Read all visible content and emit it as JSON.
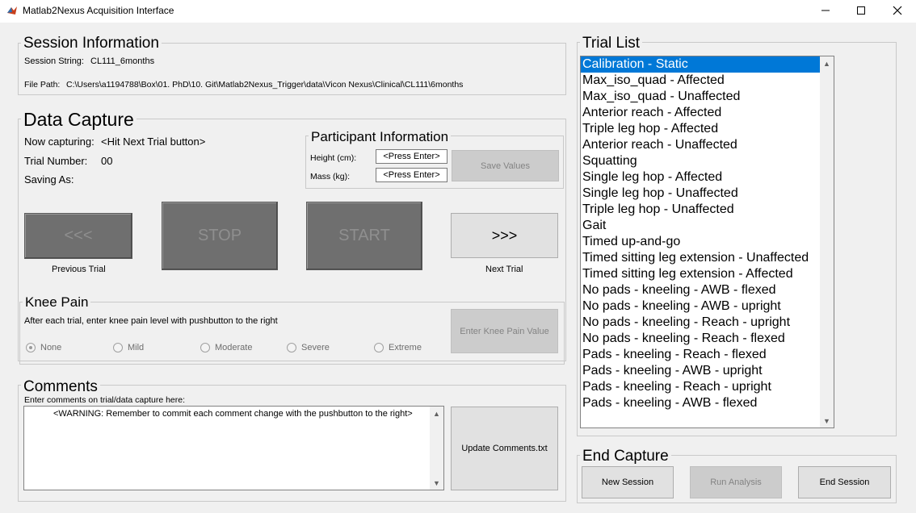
{
  "window": {
    "title": "Matlab2Nexus Acquisition Interface",
    "minimize_glyph": "—",
    "maximize_glyph": "☐",
    "close_glyph": "✕"
  },
  "session": {
    "title": "Session Information",
    "session_string_label": "Session String:",
    "session_string_value": "CL111_6months",
    "file_path_label": "File Path:",
    "file_path_value": "C:\\Users\\a1194788\\Box\\01. PhD\\10. Git\\Matlab2Nexus_Trigger\\data\\Vicon Nexus\\Clinical\\CL111\\6months"
  },
  "data_capture": {
    "title": "Data Capture",
    "now_capturing_label": "Now capturing:",
    "now_capturing_value": "<Hit Next Trial button>",
    "trial_number_label": "Trial Number:",
    "trial_number_value": "00",
    "saving_as_label": "Saving As:",
    "prev_button": "<<<",
    "prev_caption": "Previous Trial",
    "stop_button": "STOP",
    "start_button": "START",
    "next_button": ">>>",
    "next_caption": "Next Trial"
  },
  "participant": {
    "title": "Participant Information",
    "height_label": "Height (cm):",
    "height_value": "<Press Enter>",
    "mass_label": "Mass (kg):",
    "mass_value": "<Press Enter>",
    "save_button": "Save Values"
  },
  "knee_pain": {
    "title": "Knee Pain",
    "instruction": "After each trial, enter knee pain level with pushbutton to the right",
    "options": [
      "None",
      "Mild",
      "Moderate",
      "Severe",
      "Extreme"
    ],
    "selected": "None",
    "enter_button": "Enter Knee Pain Value"
  },
  "comments": {
    "title": "Comments",
    "instruction": "Enter comments on trial/data capture here:",
    "text": "<WARNING: Remember to commit each comment change with the pushbutton to the right>",
    "update_button": "Update Comments.txt"
  },
  "trial_list": {
    "title": "Trial List",
    "selected_index": 0,
    "items": [
      "Calibration - Static",
      "Max_iso_quad - Affected",
      "Max_iso_quad - Unaffected",
      "Anterior reach - Affected",
      "Triple leg hop - Affected",
      "Anterior reach - Unaffected",
      "Squatting",
      "Single leg hop - Affected",
      "Single leg hop - Unaffected",
      "Triple leg hop - Unaffected",
      "Gait",
      "Timed up-and-go",
      "Timed sitting leg extension - Unaffected",
      "Timed sitting leg extension - Affected",
      "No pads - kneeling - AWB - flexed",
      "No pads - kneeling - AWB - upright",
      "No pads - kneeling - Reach - upright",
      "No pads - kneeling - Reach - flexed",
      "Pads - kneeling - Reach - flexed",
      "Pads - kneeling - AWB - upright",
      "Pads - kneeling - Reach - upright",
      "Pads - kneeling - AWB - flexed"
    ]
  },
  "end_capture": {
    "title": "End Capture",
    "new_session": "New Session",
    "run_analysis": "Run Analysis",
    "end_session": "End Session"
  },
  "colors": {
    "selection": "#0078d7",
    "background": "#f0f0f0",
    "disabled_big_button": "#6f6f6f"
  }
}
